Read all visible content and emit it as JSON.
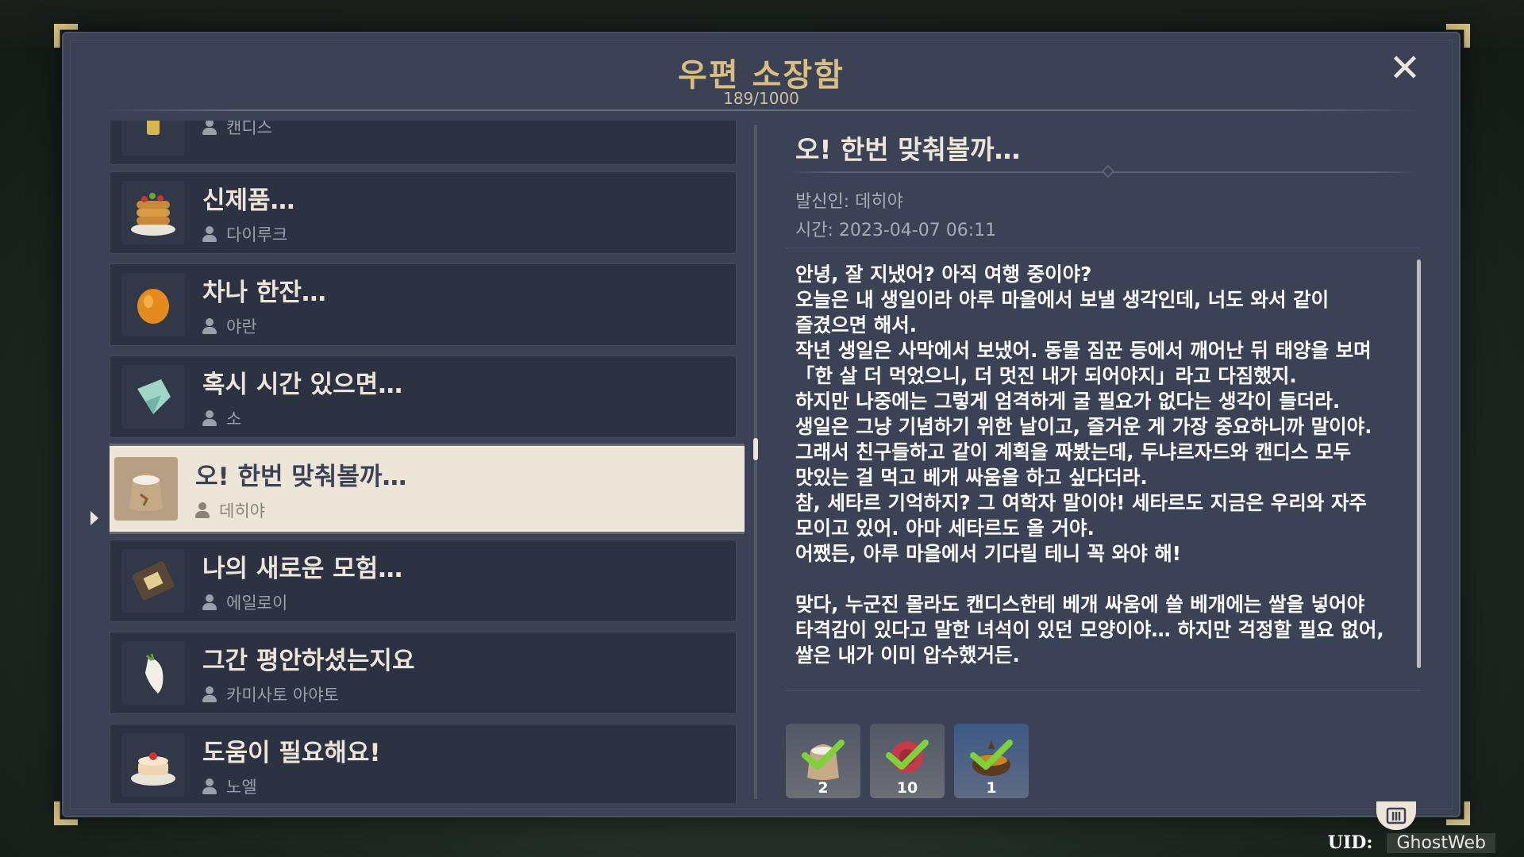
{
  "window": {
    "title": "우편 소장함",
    "counter": "189/1000",
    "close_label": "✕"
  },
  "mail_list": [
    {
      "subject": "",
      "sender": "캔디스",
      "icon": "drink-icon"
    },
    {
      "subject": "신제품…",
      "sender": "다이루크",
      "icon": "pancake-stack-icon"
    },
    {
      "subject": "차나 한잔…",
      "sender": "야란",
      "icon": "orange-fruit-icon"
    },
    {
      "subject": "혹시 시간 있으면…",
      "sender": "소",
      "icon": "crystal-icon"
    },
    {
      "subject": "오! 한번 맞춰볼까…",
      "sender": "데히야",
      "icon": "rice-sack-icon",
      "selected": true
    },
    {
      "subject": "나의 새로운 모험…",
      "sender": "에일로이",
      "icon": "map-board-icon"
    },
    {
      "subject": "그간 평안하셨는지요",
      "sender": "카미사토 아야토",
      "icon": "radish-icon"
    },
    {
      "subject": "도움이 필요해요!",
      "sender": "노엘",
      "icon": "cake-icon"
    }
  ],
  "detail": {
    "subject": "오! 한번 맞춰볼까…",
    "sender": "발신인: 데히야",
    "time": "시간: 2023-04-07 06:11",
    "body": "안녕, 잘 지냈어? 아직 여행 중이야?\n오늘은 내 생일이라 아루 마을에서 보낼 생각인데, 너도 와서 같이\n즐겼으면 해서.\n작년 생일은 사막에서 보냈어. 동물 짐꾼 등에서 깨어난 뒤 태양을 보며\n「한 살 더 먹었으니, 더 멋진 내가 되어야지」라고 다짐했지.\n하지만 나중에는 그렇게 엄격하게 굴 필요가 없다는 생각이 들더라.\n생일은 그냥 기념하기 위한 날이고, 즐거운 게 가장 중요하니까 말이야.\n그래서 친구들하고 같이 계획을 짜봤는데, 두냐르자드와 캔디스 모두\n맛있는 걸 먹고 베개 싸움을 하고 싶다더라.\n참, 세타르 기억하지? 그 여학자 말이야! 세타르도 지금은 우리와 자주\n모이고 있어. 아마 세타르도 올 거야.\n어쨌든, 아루 마을에서 기다릴 테니 꼭 와야 해!\n\n맞다, 누군진 몰라도 캔디스한테 베개 싸움에 쓸 베개에는 쌀을 넣어야\n타격감이 있다고 말한 녀석이 있던 모양이야… 하지만 걱정할 필요 없어,\n쌀은 내가 이미 압수했거든.",
    "attachments": [
      {
        "icon": "rice-bag-icon",
        "count": "2",
        "claimed": true
      },
      {
        "icon": "rose-icon",
        "count": "10",
        "claimed": true
      },
      {
        "icon": "stew-pot-icon",
        "count": "1",
        "claimed": true
      }
    ]
  },
  "footer": {
    "uid_label": "UID:",
    "uid_value": "GhostWeb"
  },
  "colors": {
    "panel_bg": "#3b4255",
    "accent_gold": "#d8be82",
    "selected_bg": "#ece5d8",
    "check_green": "#7fd13b"
  }
}
